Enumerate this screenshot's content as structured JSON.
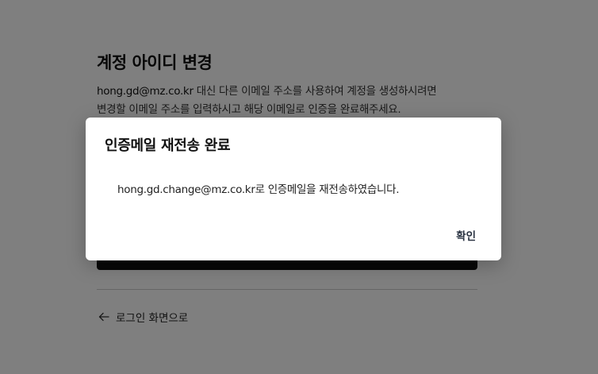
{
  "page": {
    "title": "계정 아이디 변경",
    "description_email": "hong.gd@mz.co.kr",
    "description_line1_rest": " 대신 다른 이메일 주소를 사용하여 계정을 생성하시려면",
    "description_line2": "변경할 이메일 주소를 입력하시고 해당 이메일로 인증을 완료해주세요.",
    "back_link_label": "로그인 화면으로"
  },
  "modal": {
    "title": "인증메일 재전송 완료",
    "message": "hong.gd.change@mz.co.kr로 인증메일을 재전송하였습니다.",
    "confirm_label": "확인"
  },
  "icons": {
    "back": "arrow-left-icon"
  },
  "colors": {
    "overlay": "rgba(0,0,0,0.5)",
    "primary_button": "#111111",
    "confirm_text": "#2a3342"
  }
}
